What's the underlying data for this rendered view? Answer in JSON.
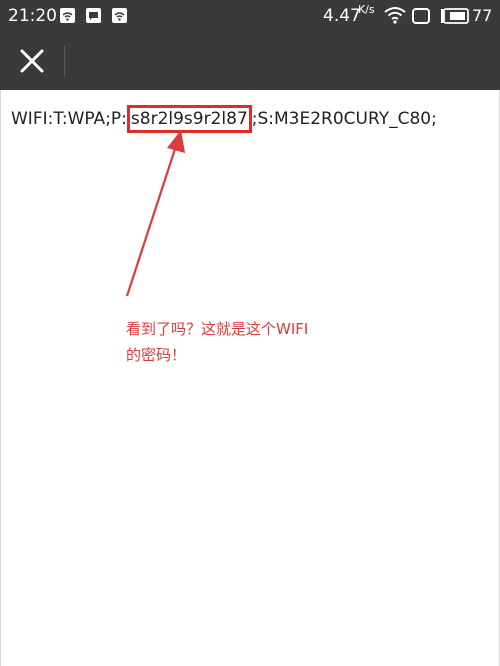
{
  "status_bar": {
    "time": "21:20",
    "net_speed": "4.47",
    "net_unit": "K/s",
    "battery": "77",
    "notification_icons": [
      "wifi-key-icon",
      "message-icon",
      "wifi-key-icon"
    ]
  },
  "toolbar": {
    "close_icon": "close-icon"
  },
  "qr_text": {
    "prefix": "WIFI:T:WPA;P:",
    "password": "s8r2l9s9r2l87",
    "suffix": ";S:M3E2R0CURY_C80;"
  },
  "annotation": {
    "line1": "看到了吗？这就是这个WIFI",
    "line2": "的密码！"
  },
  "colors": {
    "highlight": "#e02b2b",
    "annotation": "#e0393a",
    "bar": "#3a3a3a"
  }
}
